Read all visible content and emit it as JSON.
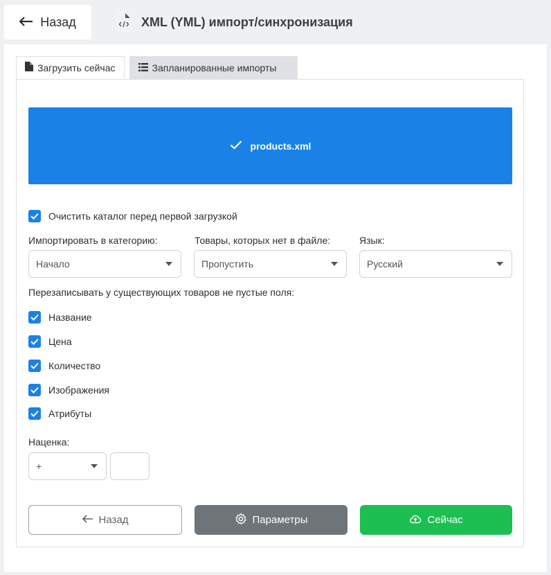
{
  "header": {
    "back_label": "Назад",
    "title": "XML (YML) импорт/синхронизация"
  },
  "tabs": [
    {
      "label": "Загрузить сейчас",
      "icon": "file-icon",
      "active": true
    },
    {
      "label": "Запланированные импорты",
      "icon": "list-icon",
      "active": false
    }
  ],
  "upload": {
    "file_name": "products.xml",
    "color": "#1a82e6"
  },
  "clear_catalog": {
    "label": "Очистить каталог перед первой загрузкой",
    "checked": true
  },
  "fields": {
    "category": {
      "label": "Импортировать в категорию:",
      "value": "Начало"
    },
    "missing": {
      "label": "Товары, которых нет в файле:",
      "value": "Пропустить"
    },
    "language": {
      "label": "Язык:",
      "value": "Русский"
    }
  },
  "overwrite": {
    "label": "Перезаписывать у существующих товаров не пустые поля:",
    "items": [
      {
        "label": "Название",
        "checked": true
      },
      {
        "label": "Цена",
        "checked": true
      },
      {
        "label": "Количество",
        "checked": true
      },
      {
        "label": "Изображения",
        "checked": true
      },
      {
        "label": "Атрибуты",
        "checked": true
      }
    ]
  },
  "markup": {
    "label": "Наценка:",
    "sign": "+",
    "value": ""
  },
  "buttons": {
    "back": "Назад",
    "params": "Параметры",
    "now": "Сейчас"
  },
  "colors": {
    "accent": "#1a82e6",
    "success": "#1dbf52",
    "secondary": "#6f7478"
  }
}
